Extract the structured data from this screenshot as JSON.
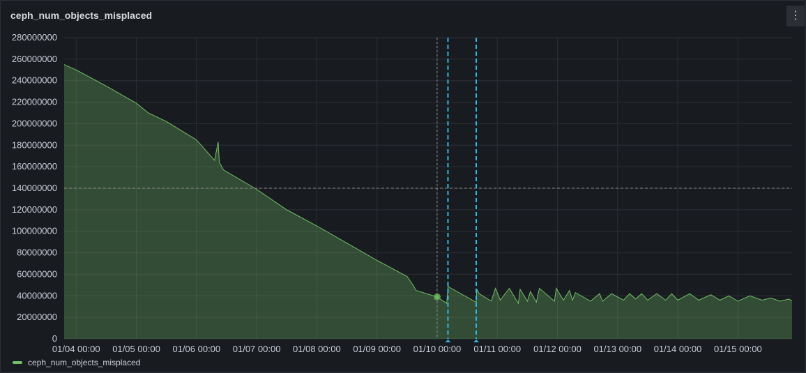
{
  "panel": {
    "title": "ceph_num_objects_misplaced",
    "menu_icon": "kebab-menu-icon"
  },
  "colors": {
    "series": "#73bf69",
    "annotation": "#33b5e5",
    "threshold": "#8e8e8e",
    "grid": "#2c2f36"
  },
  "chart_data": {
    "type": "area",
    "title": "ceph_num_objects_misplaced",
    "ylim": [
      0,
      280000000
    ],
    "y_ticks": [
      "280000000",
      "260000000",
      "240000000",
      "220000000",
      "200000000",
      "180000000",
      "160000000",
      "140000000",
      "120000000",
      "100000000",
      "80000000",
      "60000000",
      "40000000",
      "20000000",
      "0"
    ],
    "x_ticks": [
      "01/04 00:00",
      "01/05 00:00",
      "01/06 00:00",
      "01/07 00:00",
      "01/08 00:00",
      "01/09 00:00",
      "01/10 00:00",
      "01/11 00:00",
      "01/12 00:00",
      "01/13 00:00",
      "01/14 00:00",
      "01/15 00:00"
    ],
    "x_range_days": [
      -0.2,
      11.9
    ],
    "threshold": 140000000,
    "annotations_days": [
      6.18,
      6.65
    ],
    "hover_marker": {
      "x_days": 6.0,
      "y": 39000000
    },
    "legend": "ceph_num_objects_misplaced",
    "grid": true,
    "series": [
      {
        "name": "ceph_num_objects_misplaced",
        "x_days": [
          -0.2,
          0,
          0.5,
          1,
          1.2,
          1.5,
          2,
          2.3,
          2.36,
          2.38,
          2.45,
          3,
          3.5,
          3.6,
          4,
          4.5,
          5,
          5.5,
          5.6,
          5.65,
          6,
          6.16,
          6.18,
          6.2,
          6.65,
          6.66,
          6.7,
          6.9,
          6.97,
          7.05,
          7.2,
          7.35,
          7.38,
          7.5,
          7.55,
          7.65,
          7.7,
          7.95,
          7.98,
          8.1,
          8.2,
          8.25,
          8.3,
          8.55,
          8.7,
          8.75,
          8.9,
          9.1,
          9.2,
          9.3,
          9.4,
          9.5,
          9.65,
          9.8,
          9.9,
          10.0,
          10.2,
          10.35,
          10.55,
          10.7,
          10.85,
          11.0,
          11.2,
          11.4,
          11.55,
          11.7,
          11.85,
          11.9
        ],
        "values": [
          255000000,
          250000000,
          235000000,
          219000000,
          210000000,
          202000000,
          185000000,
          166000000,
          183000000,
          164000000,
          157000000,
          139000000,
          120000000,
          117000000,
          105000000,
          89000000,
          73000000,
          58000000,
          50000000,
          45000000,
          39000000,
          33000000,
          49000000,
          48000000,
          34000000,
          46000000,
          42000000,
          35000000,
          47000000,
          36000000,
          47000000,
          33000000,
          46000000,
          35000000,
          44000000,
          34000000,
          47000000,
          35000000,
          47000000,
          36000000,
          45000000,
          36000000,
          43000000,
          35000000,
          42000000,
          35000000,
          42000000,
          36000000,
          42000000,
          37000000,
          42000000,
          36000000,
          42000000,
          36000000,
          42000000,
          36000000,
          42000000,
          36000000,
          41000000,
          36000000,
          40000000,
          35000000,
          40000000,
          36000000,
          38000000,
          35000000,
          37000000,
          35000000
        ]
      }
    ]
  }
}
